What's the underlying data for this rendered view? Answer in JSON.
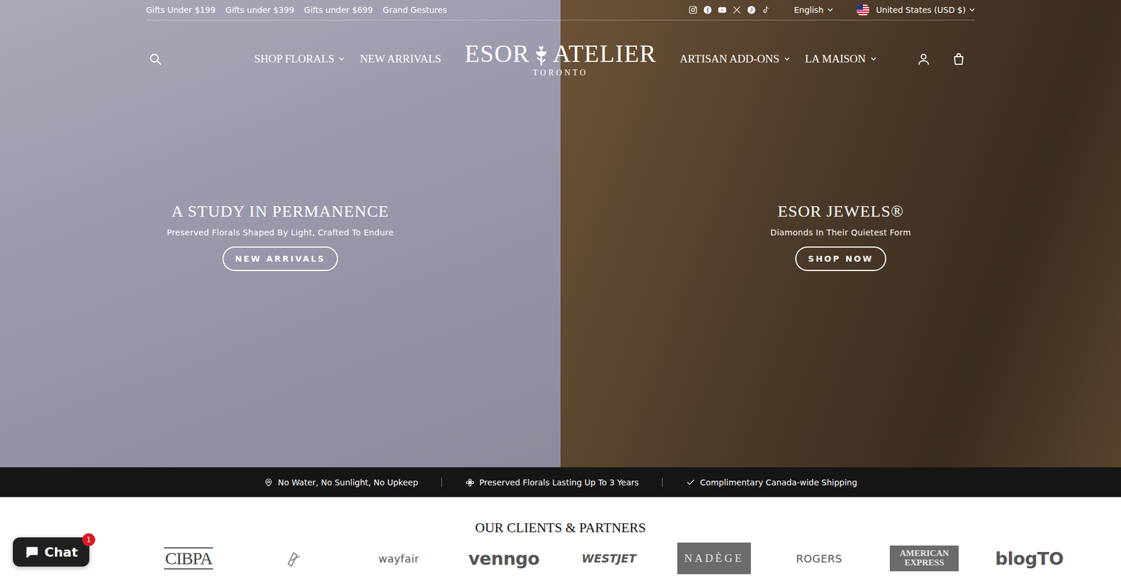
{
  "top_bar": {
    "links": [
      "Gifts Under $199",
      "Gifts under $399",
      "Gifts under $699",
      "Grand Gestures"
    ],
    "language": "English",
    "currency": "United States (USD $)"
  },
  "nav": {
    "left": [
      {
        "label": "SHOP FLORALS",
        "dropdown": true
      },
      {
        "label": "NEW ARRIVALS",
        "dropdown": false
      }
    ],
    "logo": {
      "first": "ESOR",
      "second": "ATELIER",
      "city": "TORONTO"
    },
    "right": [
      {
        "label": "ARTISAN ADD-ONS",
        "dropdown": true
      },
      {
        "label": "LA MAISON",
        "dropdown": true
      }
    ]
  },
  "hero": [
    {
      "title": "A STUDY IN PERMANENCE",
      "subtitle": "Preserved Florals Shaped By Light, Crafted To Endure",
      "button": "NEW ARRIVALS"
    },
    {
      "title": "ESOR JEWELS®",
      "subtitle": "Diamonds In Their Quietest Form",
      "button": "SHOP NOW"
    }
  ],
  "features": [
    {
      "text": "No Water, No Sunlight, No Upkeep",
      "kind": "pin"
    },
    {
      "text": "Preserved Florals Lasting Up To 3 Years",
      "kind": "flower"
    },
    {
      "text": "Complimentary Canada-wide Shipping",
      "kind": "check"
    }
  ],
  "partners": {
    "title": "OUR CLIENTS & PARTNERS",
    "logos": [
      {
        "label": "CIBPA",
        "kind": "condensed"
      },
      {
        "label": "",
        "kind": "mark"
      },
      {
        "label": "wayfair",
        "kind": "sans"
      },
      {
        "label": "venngo",
        "kind": "bold"
      },
      {
        "label": "WESTJET",
        "kind": "italic"
      },
      {
        "label": "NADÈGE",
        "kind": "boxed"
      },
      {
        "label": "ROGERS",
        "kind": "sans"
      },
      {
        "label": "AMERICAN EXPRESS",
        "kind": "boxed"
      },
      {
        "label": "blogTO",
        "kind": "bold"
      }
    ]
  },
  "chat": {
    "label": "Chat",
    "badge": "1"
  }
}
